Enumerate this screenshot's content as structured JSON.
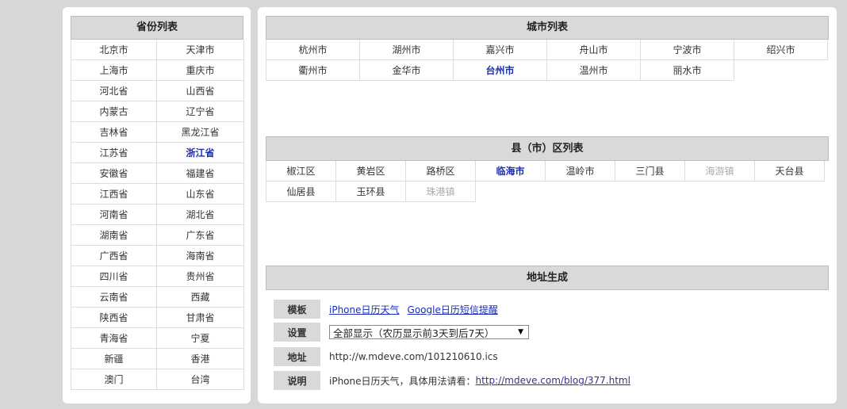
{
  "provinces": {
    "title": "省份列表",
    "items": [
      "北京市",
      "天津市",
      "上海市",
      "重庆市",
      "河北省",
      "山西省",
      "内蒙古",
      "辽宁省",
      "吉林省",
      "黑龙江省",
      "江苏省",
      "浙江省",
      "安徽省",
      "福建省",
      "江西省",
      "山东省",
      "河南省",
      "湖北省",
      "湖南省",
      "广东省",
      "广西省",
      "海南省",
      "四川省",
      "贵州省",
      "云南省",
      "西藏",
      "陕西省",
      "甘肃省",
      "青海省",
      "宁夏",
      "新疆",
      "香港",
      "澳门",
      "台湾"
    ],
    "selected": "浙江省"
  },
  "cities": {
    "title": "城市列表",
    "items": [
      "杭州市",
      "湖州市",
      "嘉兴市",
      "舟山市",
      "宁波市",
      "绍兴市",
      "衢州市",
      "金华市",
      "台州市",
      "温州市",
      "丽水市"
    ],
    "selected": "台州市"
  },
  "counties": {
    "title": "县（市）区列表",
    "items": [
      "椒江区",
      "黄岩区",
      "路桥区",
      "临海市",
      "温岭市",
      "三门县",
      "海游镇",
      "天台县",
      "仙居县",
      "玉环县",
      "珠港镇"
    ],
    "selected": "临海市",
    "disabled": [
      "海游镇",
      "珠港镇"
    ]
  },
  "generator": {
    "title": "地址生成",
    "template_label": "模板",
    "template_links": [
      "iPhone日历天气",
      "Google日历短信提醒"
    ],
    "setting_label": "设置",
    "setting_value": "全部显示（农历显示前3天到后7天）",
    "address_label": "地址",
    "address_value": "http://w.mdeve.com/101210610.ics",
    "note_label": "说明",
    "note_text": "iPhone日历天气，具体用法请看：",
    "note_link": "http://mdeve.com/blog/377.html"
  }
}
